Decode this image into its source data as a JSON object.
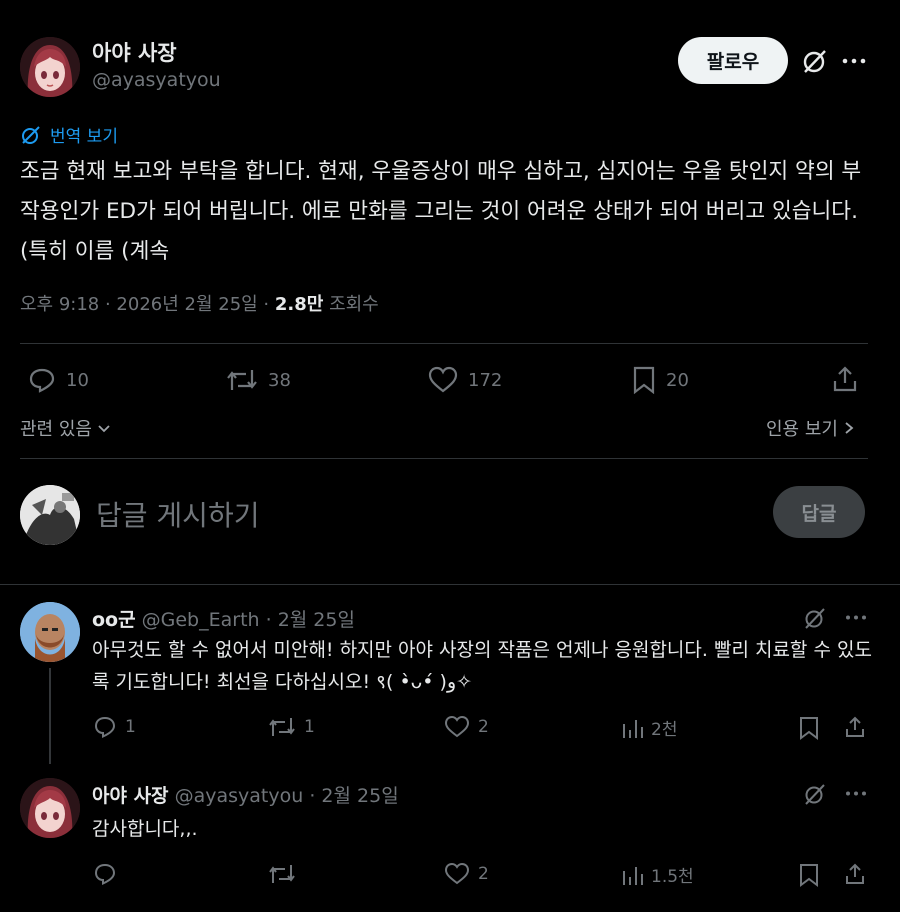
{
  "post": {
    "author_name": "아야 사장",
    "author_handle": "@ayasyatyou",
    "follow_label": "팔로우",
    "translate_label": "번역 보기",
    "text": "조금 현재 보고와 부탁을 합니다. 현재, 우울증상이 매우 심하고, 심지어는 우울 탓인지 약의 부작용인가 ED가 되어 버립니다. 에로 만화를 그리는 것이 어려운 상태가 되어 버리고 있습니다. (특히 이름 (계속",
    "time": "오후 9:18 · 2026년 2월 25일 · ",
    "views_count": "2.8만",
    "views_label": " 조회수",
    "replies": "10",
    "reposts": "38",
    "likes": "172",
    "bookmarks": "20",
    "related_label": "관련 있음",
    "quotes_label": "인용 보기"
  },
  "composer": {
    "placeholder": "답글 게시하기",
    "reply_button": "답글"
  },
  "replies": [
    {
      "name": "oo군",
      "handle": "@Geb_Earth",
      "date": "· 2월 25일",
      "text": "아무것도 할 수 없어서 미안해! 하지만 아야 사장의 작품은 언제나 응원합니다. 빨리 치료할 수 있도록 기도합니다! 최선을 다하십시오! ९( •̀ᴗ•́ )و✧",
      "replies": "1",
      "reposts": "1",
      "likes": "2",
      "views": "2천"
    },
    {
      "name": "아야 사장",
      "handle": "@ayasyatyou",
      "date": "· 2월 25일",
      "text": "감사합니다,,.",
      "replies": "",
      "reposts": "",
      "likes": "2",
      "views": "1.5천"
    }
  ],
  "colors": {
    "background": "#000000",
    "text": "#e7e9ea",
    "muted": "#71767b",
    "link": "#1d9bf0",
    "divider": "#2f3336"
  }
}
